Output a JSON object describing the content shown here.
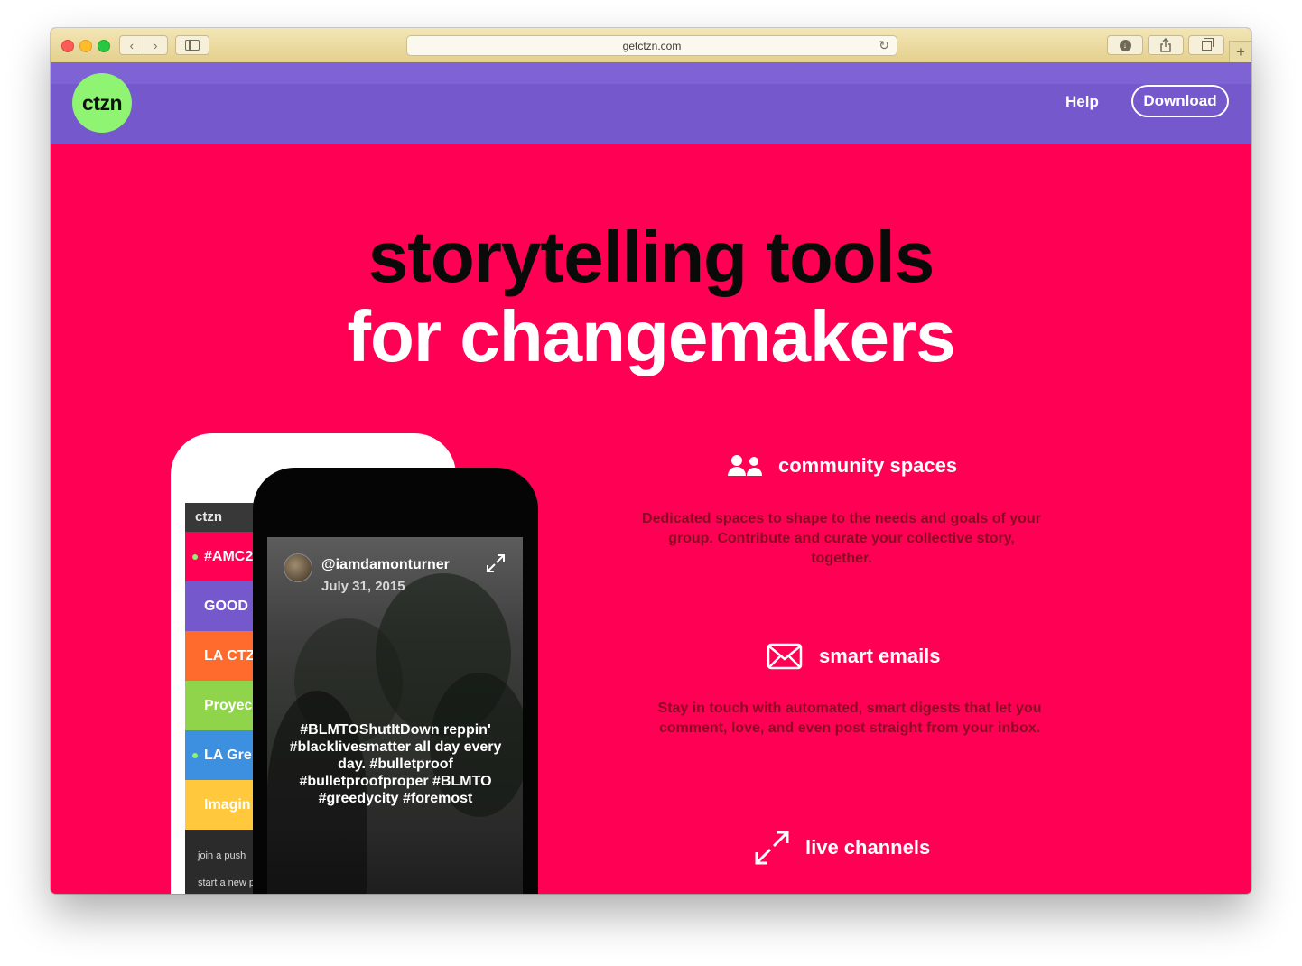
{
  "browser": {
    "url": "getctzn.com",
    "back_icon": "chevron-left-icon",
    "forward_icon": "chevron-right-icon",
    "new_tab_label": "+"
  },
  "site": {
    "logo_text": "ctzn",
    "nav": {
      "help_label": "Help",
      "download_label": "Download"
    },
    "colors": {
      "header_bg": "#7559cc",
      "hero_bg": "#ff0055",
      "logo_bg": "#8ef471"
    }
  },
  "hero": {
    "title_line1": "storytelling tools",
    "title_line2": "for changemakers"
  },
  "phone_back": {
    "app_title": "ctzn",
    "rows": [
      {
        "label": "#AMC2",
        "color": "#ff0055",
        "dot": true
      },
      {
        "label": "GOOD",
        "color": "#7559cc",
        "dot": false
      },
      {
        "label": "LA CTZ",
        "color": "#ff6b2d",
        "dot": false
      },
      {
        "label": "Proyec",
        "color": "#8fd44a",
        "dot": false
      },
      {
        "label": "LA Gre",
        "color": "#3d8fe0",
        "dot": true
      },
      {
        "label": "Imagin",
        "color": "#ffc83d",
        "dot": false
      }
    ],
    "links": [
      "join a push",
      "start a new p"
    ]
  },
  "phone_front": {
    "username": "@iamdamonturner",
    "date": "July 31, 2015",
    "caption": "#BLMTOShutItDown reppin' #blacklivesmatter all day every day. #bulletproof #bulletproofproper #BLMTO #greedycity #foremost"
  },
  "features": [
    {
      "icon": "people-icon",
      "title": "community spaces",
      "text": "Dedicated spaces to shape to the needs and goals of your group. Contribute and curate your collective story, together."
    },
    {
      "icon": "envelope-icon",
      "title": "smart emails",
      "text": "Stay in touch with automated, smart digests that let you comment, love, and even post straight from your inbox."
    },
    {
      "icon": "expand-arrows-icon",
      "title": "live channels"
    }
  ]
}
